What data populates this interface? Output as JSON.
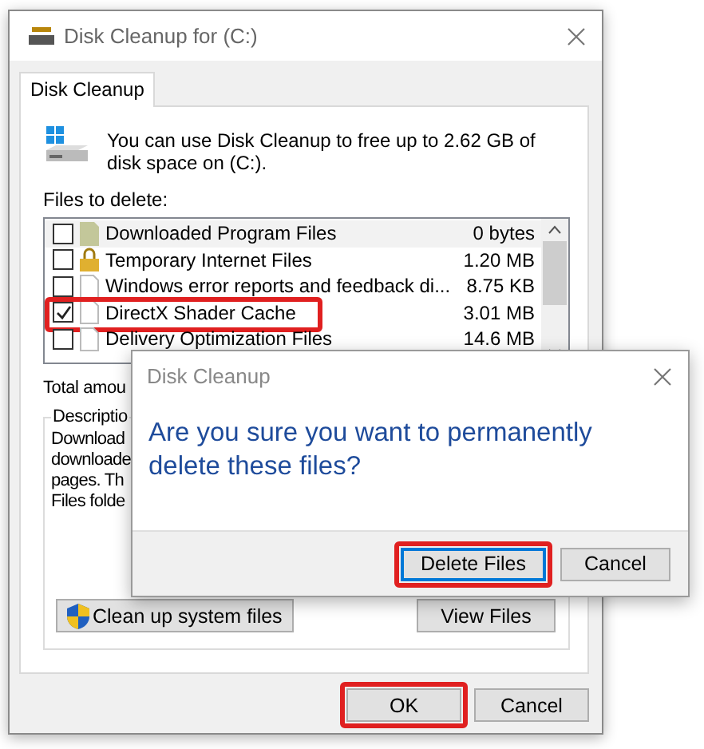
{
  "window": {
    "title": "Disk Cleanup for  (C:)"
  },
  "tabs": [
    {
      "label": "Disk Cleanup",
      "selected": true
    }
  ],
  "intro": "You can use Disk Cleanup to free up to 2.62 GB of disk space on  (C:).",
  "files_label": "Files to delete:",
  "files": [
    {
      "name": "Downloaded Program Files",
      "size": "0 bytes",
      "checked": false,
      "kind": "folder",
      "selected": true,
      "highlighted": false
    },
    {
      "name": "Temporary Internet Files",
      "size": "1.20 MB",
      "checked": false,
      "kind": "lock",
      "selected": false,
      "highlighted": false
    },
    {
      "name": "Windows error reports and feedback di...",
      "size": "8.75 KB",
      "checked": false,
      "kind": "page",
      "selected": false,
      "highlighted": false
    },
    {
      "name": "DirectX Shader Cache",
      "size": "3.01 MB",
      "checked": true,
      "kind": "page",
      "selected": false,
      "highlighted": true
    },
    {
      "name": "Delivery Optimization Files",
      "size": "14.6 MB",
      "checked": false,
      "kind": "page",
      "selected": false,
      "highlighted": false
    }
  ],
  "total_label": "Total amou",
  "description": {
    "title": "Descriptio",
    "lines": [
      "Download",
      "downloade",
      "pages. Th",
      "Files folde"
    ]
  },
  "panel_buttons": [
    {
      "label": "Clean up system files",
      "kind": "shield"
    },
    {
      "label": "View Files",
      "kind": "plain"
    }
  ],
  "buttons": [
    {
      "label": "OK",
      "highlighted": true
    },
    {
      "label": "Cancel",
      "highlighted": false
    }
  ],
  "dialog": {
    "title": "Disk Cleanup",
    "message": "Are you sure you want to permanently delete these files?",
    "buttons": [
      {
        "label": "Delete Files",
        "highlighted": true,
        "default": true
      },
      {
        "label": "Cancel",
        "highlighted": false,
        "default": false
      }
    ]
  }
}
